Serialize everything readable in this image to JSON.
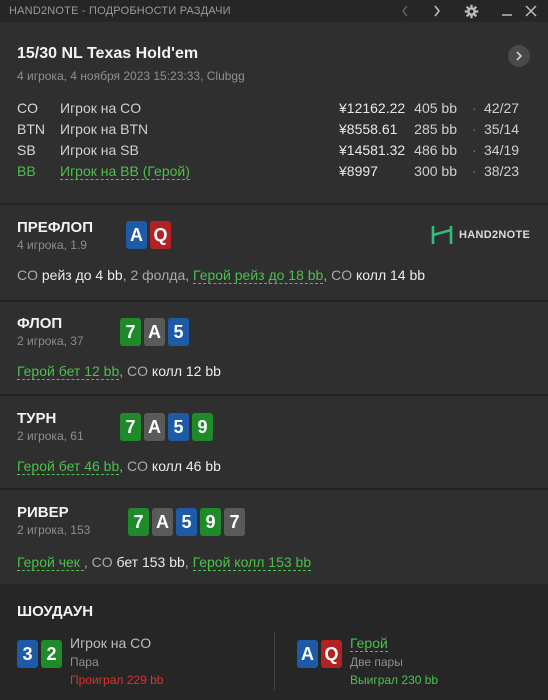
{
  "window": {
    "title": "HAND2NOTE - ПОДРОБНОСТИ РАЗДАЧИ",
    "icons": [
      "chevron-left-icon",
      "chevron-right-icon",
      "gear-icon",
      "minimize-icon",
      "close-icon"
    ]
  },
  "hand": {
    "title": "15/30 NL Texas Hold'em",
    "subtitle": "4 игрока, 4 ноября 2023 15:23:33, Clubgg"
  },
  "players": [
    {
      "pos": "CO",
      "name": "Игрок на CO",
      "stack": "¥12162.22",
      "bb": "405 bb",
      "vpip_pfr": "42/27",
      "hero": false
    },
    {
      "pos": "BTN",
      "name": "Игрок на BTN",
      "stack": "¥8558.61",
      "bb": "285 bb",
      "vpip_pfr": "35/14",
      "hero": false
    },
    {
      "pos": "SB",
      "name": "Игрок на SB",
      "stack": "¥14581.32",
      "bb": "486 bb",
      "vpip_pfr": "34/19",
      "hero": false
    },
    {
      "pos": "BB",
      "name": "Игрок на BB (Герой)",
      "stack": "¥8997",
      "bb": "300 bb",
      "vpip_pfr": "38/23",
      "hero": true
    }
  ],
  "logo": {
    "text": "HAND2NOTE"
  },
  "preflop": {
    "name": "ПРЕФЛОП",
    "sub": "4 игрока, 1.9",
    "cards": [
      {
        "rank": "A",
        "color": "blue"
      },
      {
        "rank": "Q",
        "color": "red"
      }
    ],
    "actions": {
      "p1": "CO",
      "a1": "рейз до 4 bb",
      "sep1": ", 2 фолда, ",
      "hero": "Герой рейз до 18 bb",
      "sep2": ", ",
      "p2": "CO",
      "a2": "колл 14 bb"
    }
  },
  "flop": {
    "name": "ФЛОП",
    "sub": "2 игрока, 37",
    "cards": [
      {
        "rank": "7",
        "color": "green"
      },
      {
        "rank": "A",
        "color": "gray"
      },
      {
        "rank": "5",
        "color": "blue"
      }
    ],
    "actions": {
      "hero": "Герой бет 12 bb",
      "sep1": ", ",
      "p1": "CO",
      "a1": "колл 12 bb"
    }
  },
  "turn": {
    "name": "ТУРН",
    "sub": "2 игрока, 61",
    "cards": [
      {
        "rank": "7",
        "color": "green"
      },
      {
        "rank": "A",
        "color": "gray"
      },
      {
        "rank": "5",
        "color": "blue"
      },
      {
        "rank": "9",
        "color": "green"
      }
    ],
    "actions": {
      "hero": "Герой бет 46 bb",
      "sep1": ", ",
      "p1": "CO",
      "a1": "колл 46 bb"
    }
  },
  "river": {
    "name": "РИВЕР",
    "sub": "2 игрока, 153",
    "cards": [
      {
        "rank": "7",
        "color": "green"
      },
      {
        "rank": "A",
        "color": "gray"
      },
      {
        "rank": "5",
        "color": "blue"
      },
      {
        "rank": "9",
        "color": "green"
      },
      {
        "rank": "7",
        "color": "gray"
      }
    ],
    "actions": {
      "hero": "Герой чек ",
      "sep1": ", ",
      "p1": "CO",
      "a1": "бет 153 bb",
      "sep2": ", ",
      "hero2": "Герой колл 153 bb"
    }
  },
  "showdown": {
    "title": "ШОУДАУН",
    "left": {
      "cards": [
        {
          "rank": "3",
          "color": "blue"
        },
        {
          "rank": "2",
          "color": "green"
        }
      ],
      "name": "Игрок на CO",
      "combo": "Пара",
      "result": "Проиграл 229 bb"
    },
    "right": {
      "cards": [
        {
          "rank": "A",
          "color": "blue"
        },
        {
          "rank": "Q",
          "color": "red"
        }
      ],
      "name": "Герой",
      "combo": "Две пары",
      "result": "Выиграл 230 bb"
    }
  },
  "colors": {
    "hero": "#4cc04c",
    "lost": "#e03030",
    "card_green": "#1f8a2a",
    "card_blue": "#1d5aa8",
    "card_red": "#b32222",
    "card_gray": "#5a5a5a"
  }
}
